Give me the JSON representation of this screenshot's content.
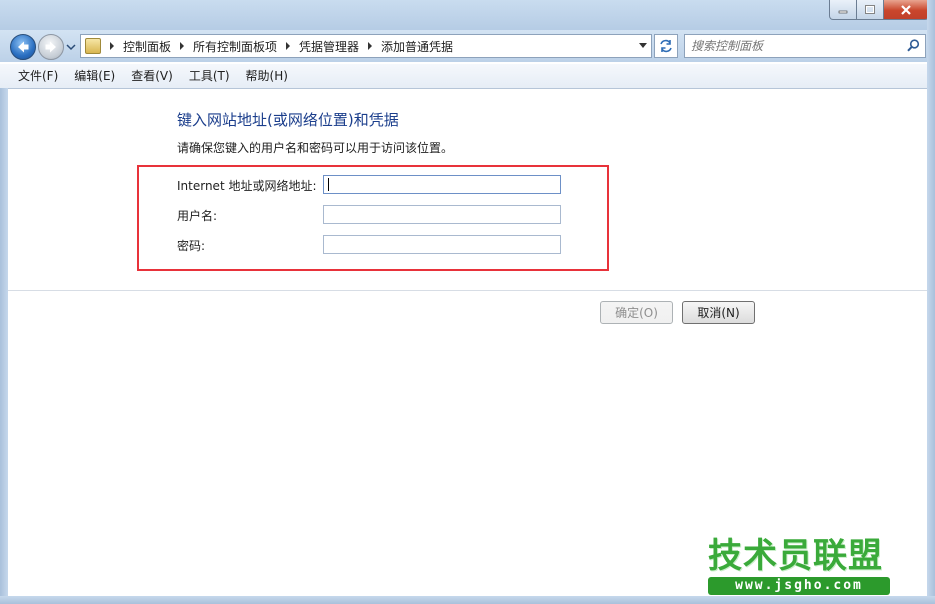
{
  "window": {
    "caption_buttons": [
      "minimize-icon",
      "maximize-icon",
      "close-icon"
    ]
  },
  "address": {
    "breadcrumbs": [
      "控制面板",
      "所有控制面板项",
      "凭据管理器",
      "添加普通凭据"
    ]
  },
  "search": {
    "placeholder": "搜索控制面板"
  },
  "menu": {
    "items": [
      "文件(F)",
      "编辑(E)",
      "查看(V)",
      "工具(T)",
      "帮助(H)"
    ]
  },
  "main": {
    "heading": "键入网站地址(或网络位置)和凭据",
    "description": "请确保您键入的用户名和密码可以用于访问该位置。",
    "fields": [
      {
        "label": "Internet 地址或网络地址:",
        "value": ""
      },
      {
        "label": "用户名:",
        "value": ""
      },
      {
        "label": "密码:",
        "value": ""
      }
    ],
    "ok_label": "确定(O)",
    "cancel_label": "取消(N)"
  },
  "watermark": {
    "title": "技术员联盟",
    "url": "www.jsgho.com"
  },
  "colors": {
    "heading": "#1b3e8c",
    "highlight_box": "#e8323a",
    "watermark": "#3aaa3a"
  }
}
